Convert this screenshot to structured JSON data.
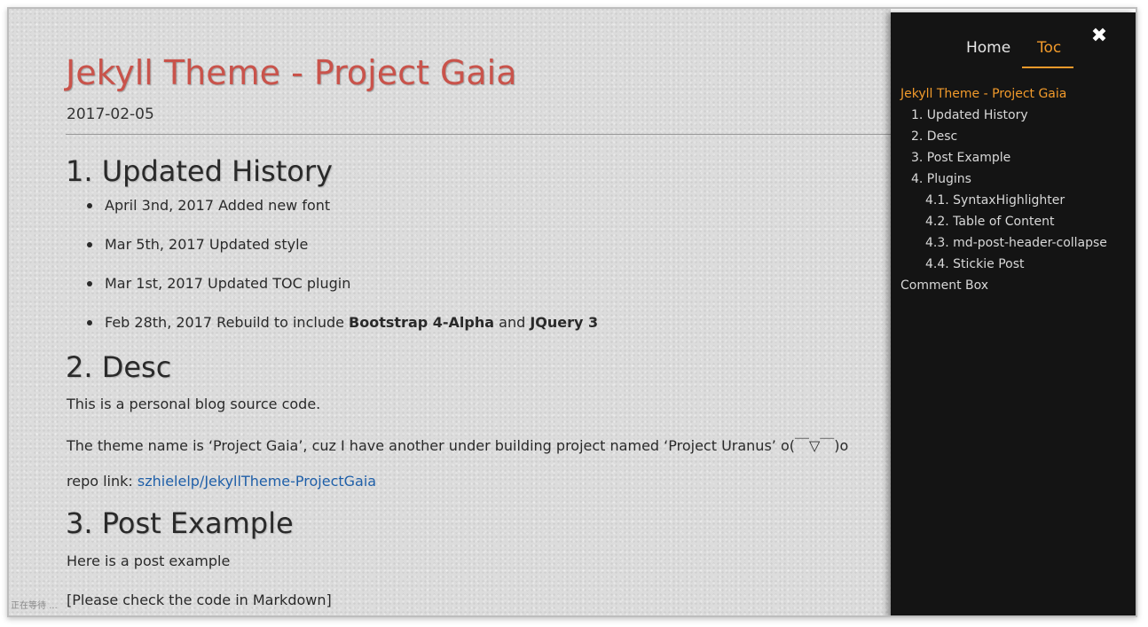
{
  "post": {
    "title": "Jekyll Theme - Project Gaia",
    "date": "2017-02-05"
  },
  "sections": {
    "history": {
      "heading": "1. Updated History",
      "items": [
        {
          "text": "April 3nd, 2017 Added new font"
        },
        {
          "text": "Mar 5th, 2017 Updated style"
        },
        {
          "text": "Mar 1st, 2017 Updated TOC plugin"
        },
        {
          "prefix": "Feb 28th, 2017 Rebuild to include ",
          "bold1": "Bootstrap 4-Alpha",
          "mid": " and ",
          "bold2": "JQuery 3"
        }
      ]
    },
    "desc": {
      "heading": "2. Desc",
      "para1": "This is a personal blog source code.",
      "para2": "The theme name is ‘Project Gaia’, cuz I have another under building project named ‘Project Uranus’ o(￣▽￣)o",
      "repo_label": "repo link: ",
      "repo_link": "szhielelp/JekyllTheme-ProjectGaia"
    },
    "example": {
      "heading": "3. Post Example",
      "para1": "Here is a post example",
      "para2": "[Please check the code in Markdown]"
    }
  },
  "status_text": "正在等待 ...",
  "sidebar": {
    "tabs": [
      "Home",
      "Toc"
    ],
    "active_tab": "Toc",
    "close_icon": "close-icon",
    "toc": [
      {
        "label": "Jekyll Theme - Project Gaia",
        "level": 0,
        "active": true
      },
      {
        "label": "1. Updated History",
        "level": 1
      },
      {
        "label": "2. Desc",
        "level": 1
      },
      {
        "label": "3. Post Example",
        "level": 1
      },
      {
        "label": "4. Plugins",
        "level": 1
      },
      {
        "label": "4.1. SyntaxHighlighter",
        "level": 2
      },
      {
        "label": "4.2. Table of Content",
        "level": 2
      },
      {
        "label": "4.3. md-post-header-collapse",
        "level": 2
      },
      {
        "label": "4.4. Stickie Post",
        "level": 2
      },
      {
        "label": "Comment Box",
        "level": 0
      }
    ]
  },
  "colors": {
    "title_red": "#c9534b",
    "accent_orange": "#f19a2b",
    "sidebar_bg": "#141414",
    "link_blue": "#1f5fa8"
  }
}
